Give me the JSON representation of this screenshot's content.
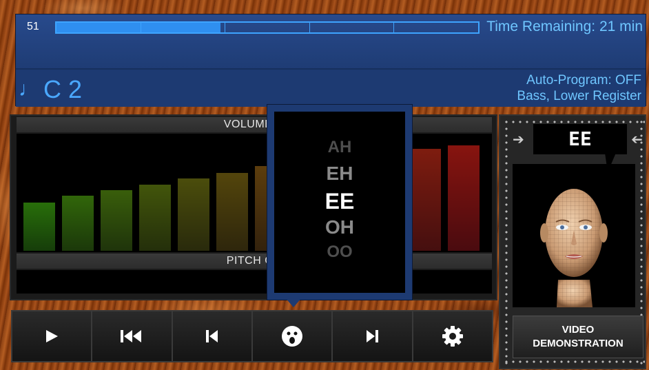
{
  "status": {
    "counter": "51",
    "progress_fraction": 0.39,
    "segments": 5,
    "time_remaining": "Time Remaining: 21 min"
  },
  "note": {
    "glyph": "♩",
    "pitch": "C 2"
  },
  "auto_program": {
    "line1": "Auto-Program: OFF",
    "line2": "Bass, Lower Register"
  },
  "volume": {
    "label": "VOLUME G",
    "levels": [
      0.42,
      0.48,
      0.53,
      0.58,
      0.63,
      0.68,
      0.74,
      0.78,
      0.82,
      0.86,
      0.89,
      0.92
    ]
  },
  "pitch_guide": {
    "label": "PITCH GU"
  },
  "vowel_menu": {
    "options": [
      "AH",
      "EH",
      "EE",
      "OH",
      "OO"
    ],
    "selected": "EE"
  },
  "face_panel": {
    "current_vowel": "EE",
    "video_button": "VIDEO DEMONSTRATION"
  },
  "transport": {
    "buttons": [
      "play-icon",
      "rewind-to-start-icon",
      "previous-icon",
      "face-mouth-icon",
      "next-icon",
      "settings-gear-icon"
    ]
  },
  "colors": {
    "accent_blue": "#3ea4ff",
    "panel_blue": "#1d3a72"
  }
}
